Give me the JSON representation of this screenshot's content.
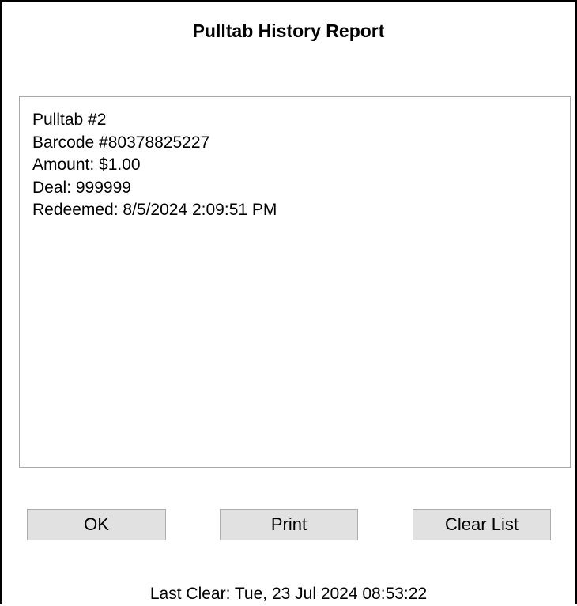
{
  "dialog": {
    "title": "Pulltab History Report"
  },
  "report": {
    "lines": [
      "Pulltab #2",
      "Barcode #80378825227",
      "Amount: $1.00",
      "Deal: 999999",
      "Redeemed: 8/5/2024 2:09:51 PM"
    ]
  },
  "buttons": {
    "ok_label": "OK",
    "print_label": "Print",
    "clear_label": "Clear List"
  },
  "footer": {
    "last_clear": "Last Clear: Tue, 23 Jul 2024 08:53:22"
  },
  "colors": {
    "button_face": "#e1e1e1",
    "button_border": "#adadad",
    "listbox_border": "#a9a9a9",
    "window_border": "#000000"
  }
}
